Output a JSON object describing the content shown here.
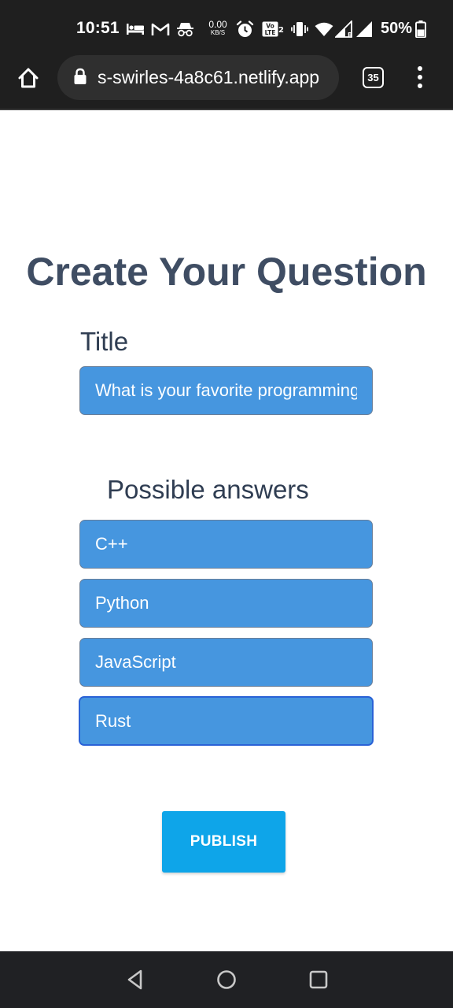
{
  "status_bar": {
    "time": "10:51",
    "net_speed_value": "0.00",
    "net_speed_unit": "KB/S",
    "battery_percent": "50%",
    "icons": [
      "bed-icon",
      "gmail-icon",
      "incognito-icon",
      "alarm-icon",
      "volte-icon",
      "vibrate-icon",
      "wifi-icon",
      "signal-icon",
      "signal-icon",
      "battery-icon"
    ]
  },
  "browser": {
    "url": "s-swirles-4a8c61.netlify.app",
    "tab_count": "35",
    "icons": [
      "home-icon",
      "lock-icon",
      "more-vert-icon"
    ]
  },
  "page": {
    "title": "Create Your Question",
    "title_label": "Title",
    "title_value": "What is your favorite programming language?",
    "answers_label": "Possible answers",
    "answers": [
      "C++",
      "Python",
      "JavaScript",
      "Rust"
    ],
    "publish_label": "PUBLISH",
    "colors": {
      "heading": "#3f4d63",
      "field_bg": "#4696df",
      "focused_border": "#2a62d6",
      "publish_bg": "#0ea5e9"
    }
  },
  "nav_bar": {
    "icons": [
      "back-icon",
      "home-circle-icon",
      "recents-icon"
    ]
  }
}
